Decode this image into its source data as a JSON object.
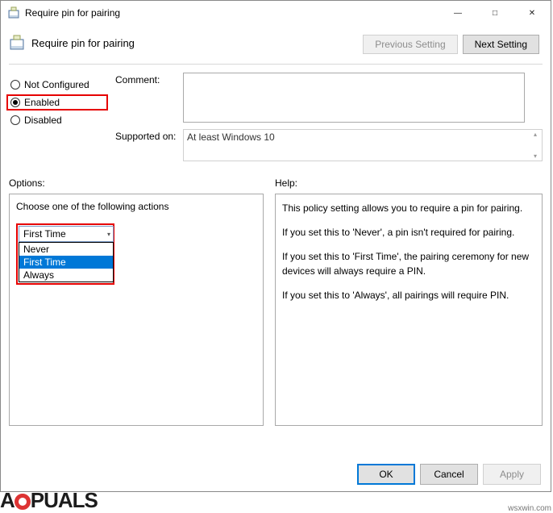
{
  "window": {
    "title": "Require pin for pairing"
  },
  "header": {
    "title": "Require pin for pairing",
    "prev_label": "Previous Setting",
    "next_label": "Next Setting"
  },
  "config": {
    "not_configured": "Not Configured",
    "enabled": "Enabled",
    "disabled": "Disabled",
    "selected": "enabled",
    "comment_label": "Comment:",
    "comment_value": "",
    "supported_label": "Supported on:",
    "supported_value": "At least Windows 10"
  },
  "panels": {
    "options_label": "Options:",
    "help_label": "Help:"
  },
  "options": {
    "prompt": "Choose one of the following actions",
    "selected_value": "First Time",
    "items": [
      "Never",
      "First Time",
      "Always"
    ],
    "highlighted_index": 1
  },
  "help": {
    "p1": "This policy setting allows you to require a pin for pairing.",
    "p2": "If you set this to 'Never', a pin isn't required for pairing.",
    "p3": "If you set this to 'First Time', the pairing ceremony for new devices will always require a PIN.",
    "p4": "If you set this to 'Always', all pairings will require PIN."
  },
  "footer": {
    "ok": "OK",
    "cancel": "Cancel",
    "apply": "Apply"
  },
  "watermark": {
    "pre": "A",
    "post": "PUALS"
  },
  "credit": "wsxwin.com"
}
